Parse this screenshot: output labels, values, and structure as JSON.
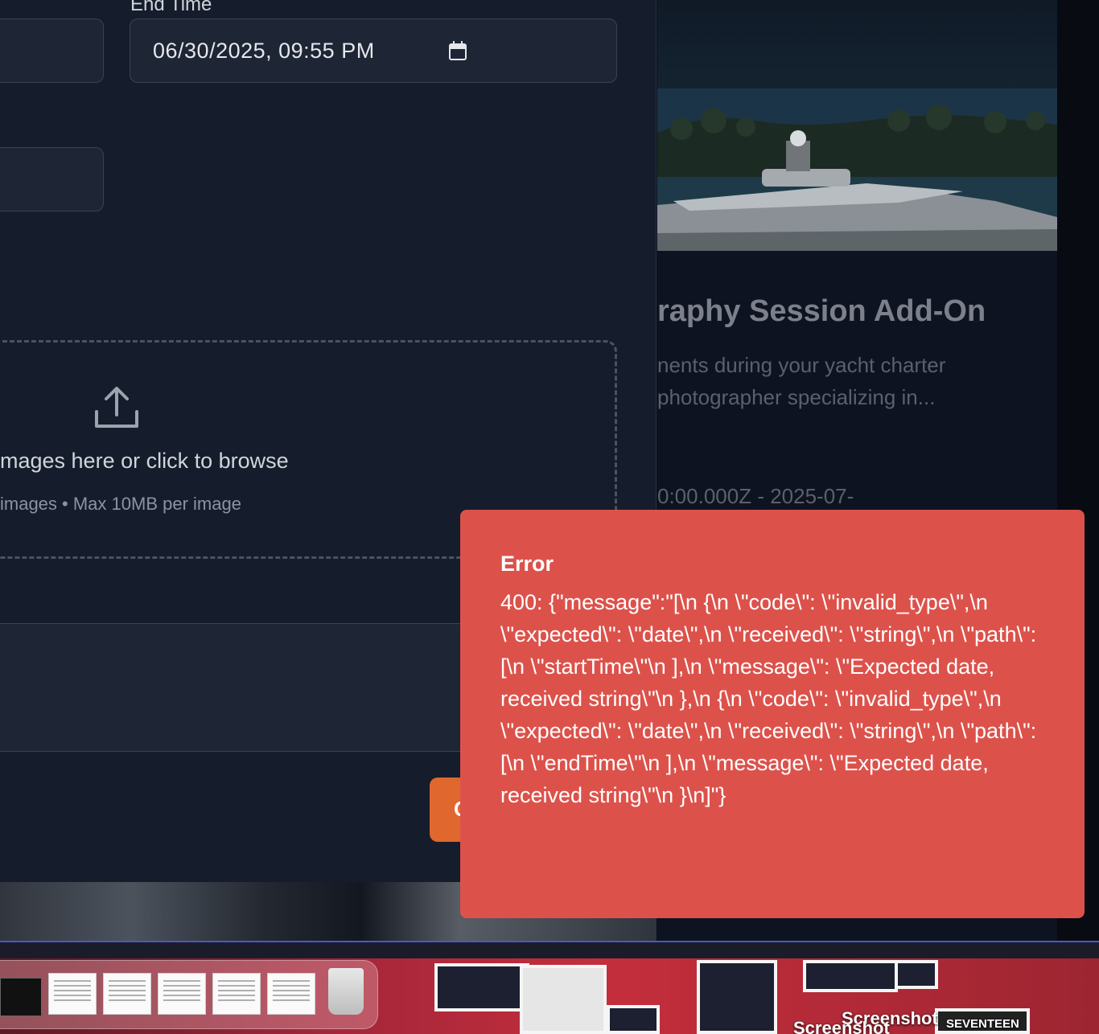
{
  "form": {
    "end_time_label": "End Time",
    "end_time_value": "06/30/2025, 09:55 PM",
    "dropzone_text": "mages here or click to browse",
    "dropzone_hint": "images • Max 10MB per image",
    "submit_label": "C"
  },
  "card": {
    "title": "raphy Session Add-On",
    "description": "nents during your yacht charter\nphotographer specializing in...",
    "time_range": "0:00.000Z - 2025-07-"
  },
  "toast": {
    "title": "Error",
    "message": "400: {\"message\":\"[\\n {\\n \\\"code\\\": \\\"invalid_type\\\",\\n \\\"expected\\\": \\\"date\\\",\\n \\\"received\\\": \\\"string\\\",\\n \\\"path\\\": [\\n \\\"startTime\\\"\\n ],\\n \\\"message\\\": \\\"Expected date, received string\\\"\\n },\\n {\\n \\\"code\\\": \\\"invalid_type\\\",\\n \\\"expected\\\": \\\"date\\\",\\n \\\"received\\\": \\\"string\\\",\\n \\\"path\\\": [\\n \\\"endTime\\\"\\n ],\\n \\\"message\\\": \\\"Expected date, received string\\\"\\n }\\n]\"}",
    "color": "#dc524b"
  },
  "desktop": {
    "label_1": "Screenshot",
    "label_2": "Screenshot",
    "label_3": "SEVENTEEN"
  },
  "colors": {
    "accent": "#e0672e",
    "panel": "#151c2b",
    "input_bg": "#1e2535"
  }
}
